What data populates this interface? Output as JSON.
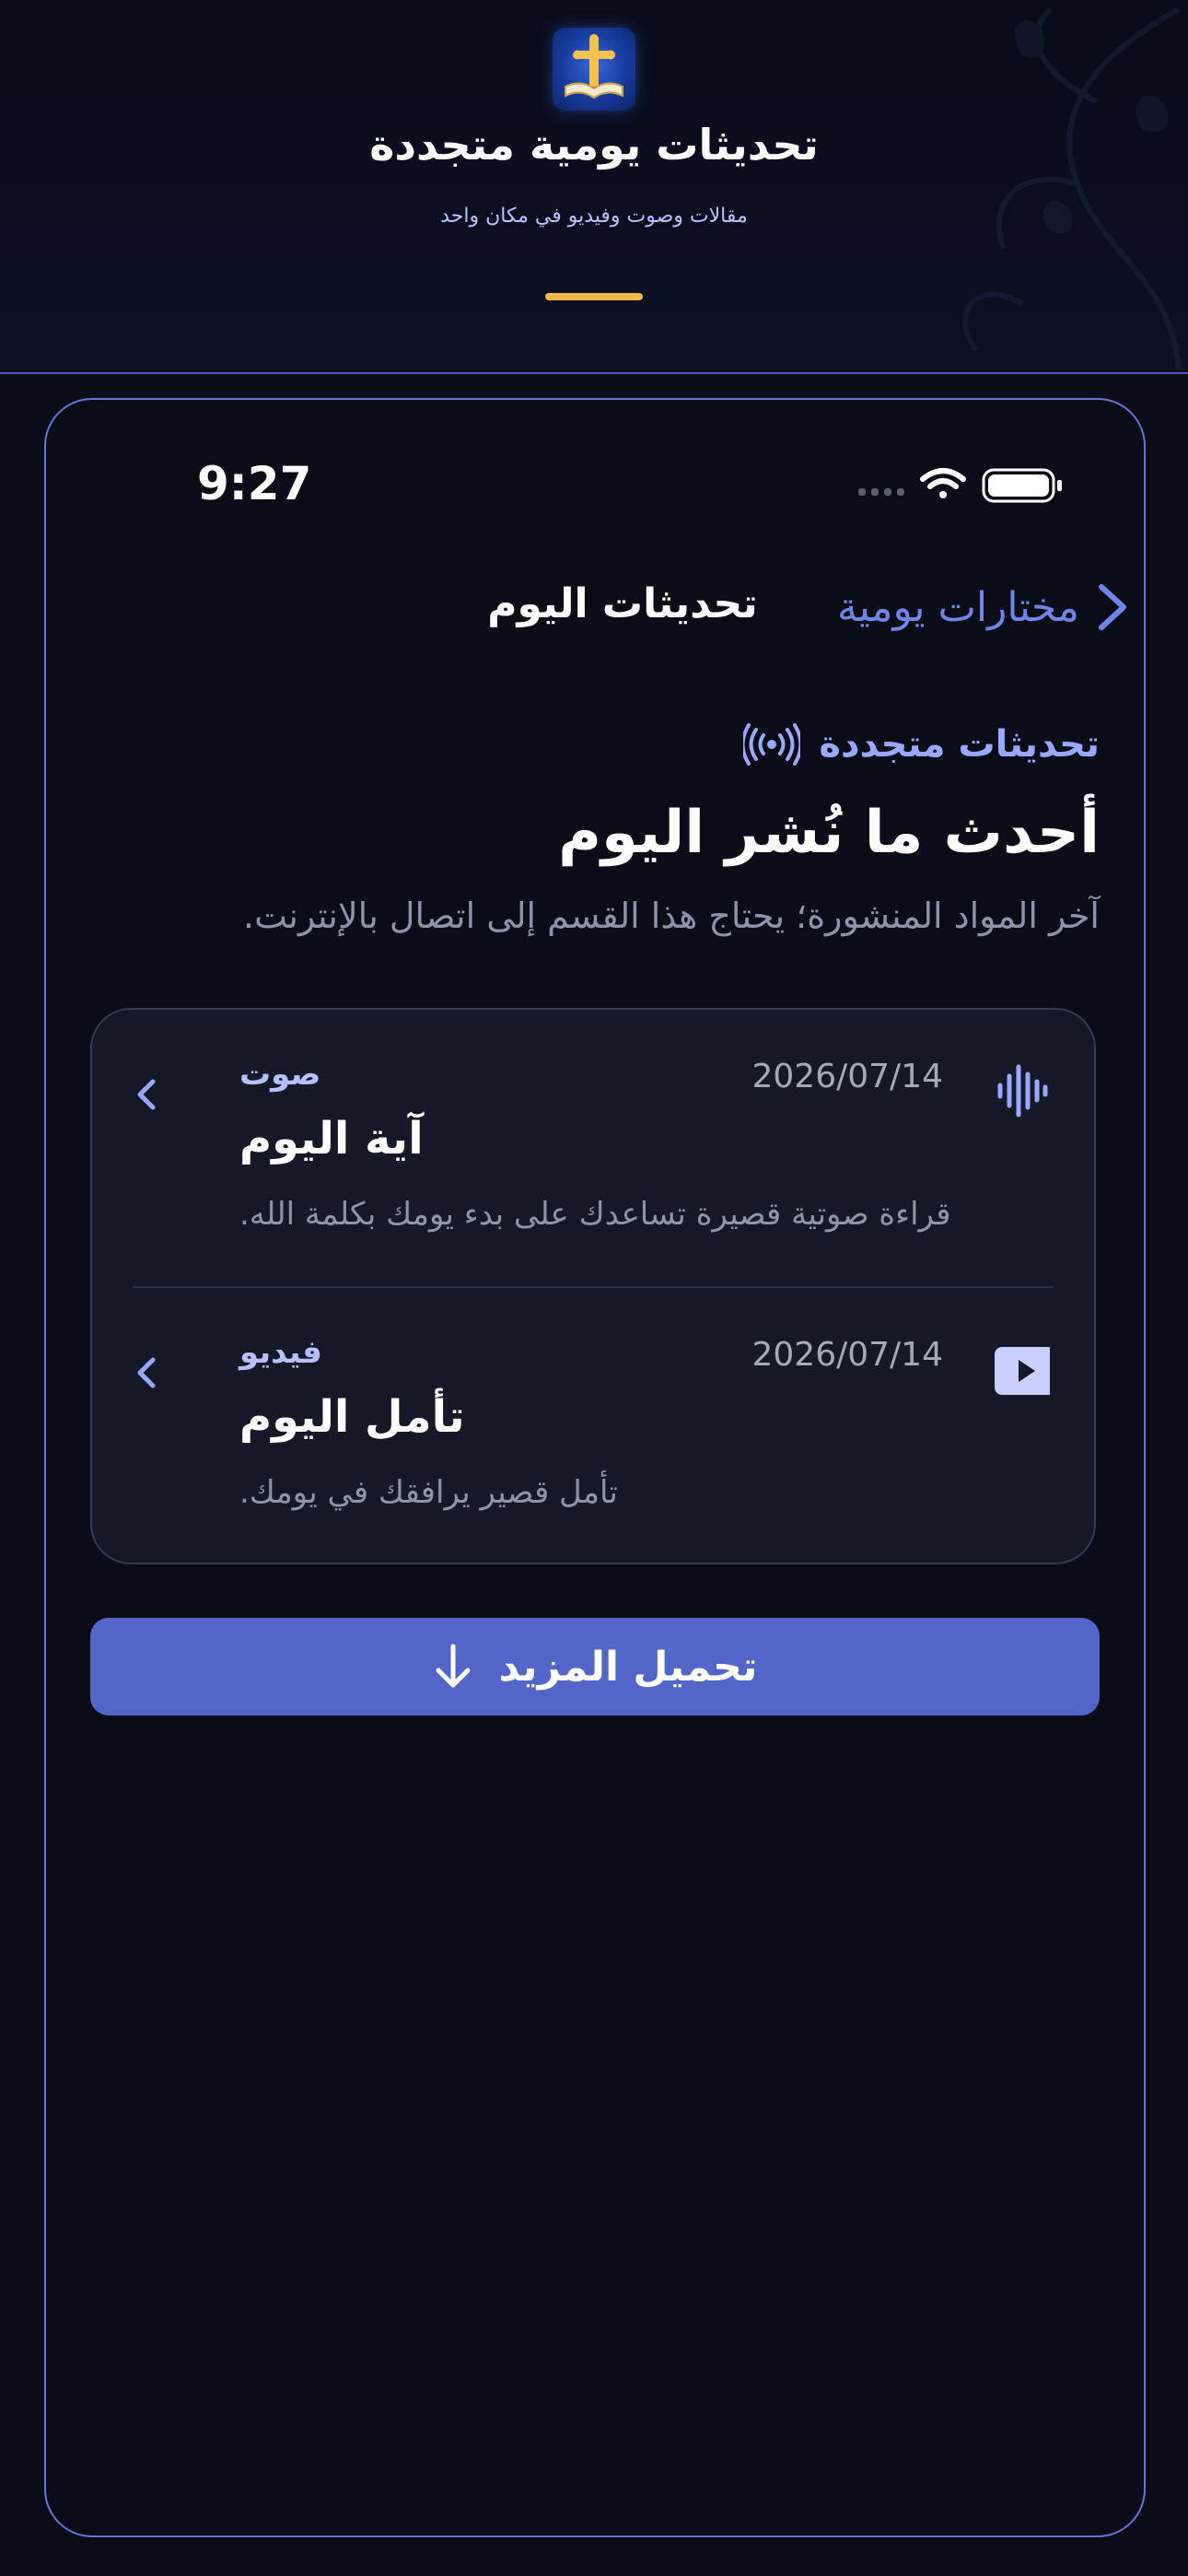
{
  "colors": {
    "background": "#0a0c18",
    "accent": "#6f86e8",
    "button": "#5366c8",
    "highlight_bar": "#f2b84c",
    "card": "#141827"
  },
  "hero": {
    "logo_icon": "cross-bible-icon",
    "title": "تحديثات يومية متجددة",
    "subtitle": "مقالات وصوت وفيديو في مكان واحد"
  },
  "status_bar": {
    "time": "9:27",
    "icons": [
      "cellular-icon",
      "wifi-icon",
      "battery-icon"
    ]
  },
  "nav": {
    "title": "تحديثات اليوم",
    "back_label": "مختارات يومية",
    "back_icon": "chevron-right-icon"
  },
  "section": {
    "eyebrow_icon": "broadcast-icon",
    "eyebrow": "تحديثات متجددة",
    "headline": "أحدث ما نُشر اليوم",
    "lede": "آخر المواد المنشورة؛ يحتاج هذا القسم إلى اتصال بالإنترنت."
  },
  "items": [
    {
      "icon": "audio-waveform-icon",
      "date": "2026/07/14",
      "type": "صوت",
      "title": "آية اليوم",
      "description": "قراءة صوتية قصيرة تساعدك على بدء يومك بكلمة الله."
    },
    {
      "icon": "video-play-icon",
      "date": "2026/07/14",
      "type": "فيديو",
      "title": "تأمل اليوم",
      "description": "تأمل قصير يرافقك في يومك."
    }
  ],
  "load_more": {
    "label": "تحميل المزيد",
    "icon": "arrow-down-icon"
  }
}
